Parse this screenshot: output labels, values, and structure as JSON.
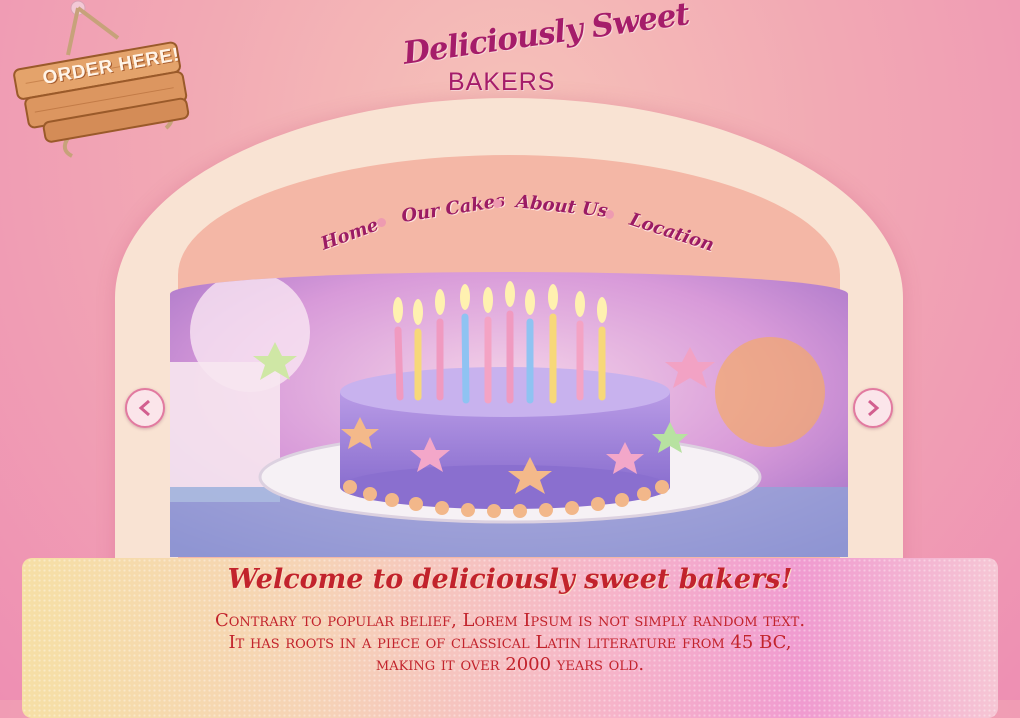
{
  "order_sign": {
    "label": "ORDER HERE!"
  },
  "logo": {
    "script": "Deliciously Sweet",
    "word": "BAKERS"
  },
  "nav": {
    "items": [
      {
        "label": "Home"
      },
      {
        "label": "Our Cakes"
      },
      {
        "label": "About Us"
      },
      {
        "label": "Location"
      }
    ]
  },
  "slider": {
    "prev_icon": "chevron-left-icon",
    "next_icon": "chevron-right-icon",
    "image": "birthday-cake-with-candles"
  },
  "welcome": {
    "title": "Welcome to deliciously sweet bakers!",
    "lines": [
      "Contrary to popular belief, Lorem Ipsum is not simply random text.",
      "It has roots in a piece of classical Latin literature from 45 BC,",
      "making it over 2000 years old."
    ]
  },
  "colors": {
    "accent": "#a51d6a",
    "text_red": "#c2232c",
    "arch": "#f9e3d3"
  }
}
